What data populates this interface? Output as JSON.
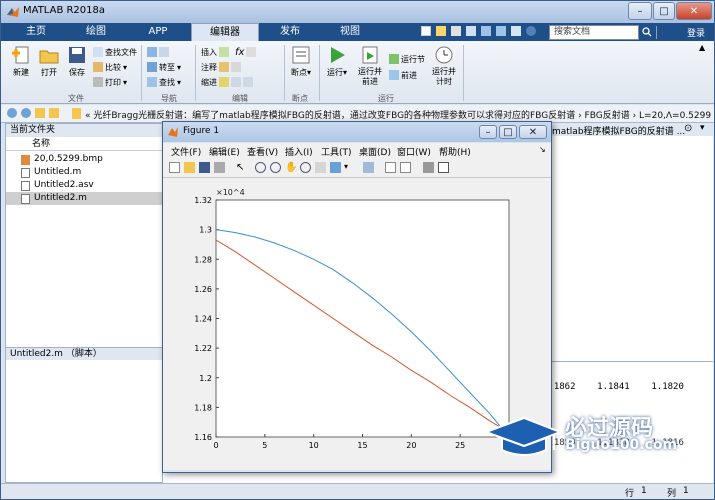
{
  "app": {
    "title": "MATLAB R2018a"
  },
  "ribbon_tabs": [
    "主页",
    "绘图",
    "APP",
    "编辑器",
    "发布",
    "视图"
  ],
  "search": {
    "placeholder": "搜索文档",
    "login": "登录"
  },
  "ribbon": {
    "file_group": {
      "label": "文件",
      "new": "新建",
      "open": "打开",
      "save": "保存",
      "find_files": "查找文件",
      "compare": "比较",
      "print": "打印"
    },
    "nav_group": {
      "label": "导航",
      "goto": "转至",
      "find": "查找"
    },
    "edit_group": {
      "label": "编辑",
      "insert": "插入",
      "comment": "注释",
      "indent": "缩进",
      "fx": "fx"
    },
    "bp_group": {
      "label": "断点",
      "breakpoint": "断点"
    },
    "run_group": {
      "label": "运行",
      "run": "运行",
      "run_advance": "运行并前进",
      "run_section": "运行节",
      "advance": "前进",
      "run_time": "运行并计时"
    }
  },
  "address": {
    "path": "« 光纤Bragg光栅反射谱：编写了matlab程序模拟FBG的反射谱，通过改变FBG的各种物理参数可以求得对应的FBG反射谱 › FBG反射谱 › L=20,Λ=0.5299"
  },
  "left_panel": {
    "header": "当前文件夹",
    "column": "名称",
    "files": [
      "20,0.5299.bmp",
      "Untitled.m",
      "Untitled2.asv",
      "Untitled2.m"
    ],
    "selected_index": 3,
    "detail_header": "Untitled2.m （脚本）"
  },
  "editor": {
    "tab_partial": "matlab程序模拟FBG的反射谱 ..."
  },
  "command": {
    "row1": "1.1862    1.1841    1.1820",
    "row2": "1.1859    1.1838    1.1816"
  },
  "status": {
    "row_label": "行",
    "row": "1",
    "col_label": "列",
    "col": "1"
  },
  "figure": {
    "title": "Figure 1",
    "menu": [
      "文件(F)",
      "编辑(E)",
      "查看(V)",
      "插入(I)",
      "工具(T)",
      "桌面(D)",
      "窗口(W)",
      "帮助(H)"
    ]
  },
  "watermark": {
    "text": "必过源码",
    "url": "Biguo100.com"
  },
  "chart_data": {
    "type": "line",
    "multiplier": "×10^4",
    "xlim": [
      0,
      30
    ],
    "ylim": [
      1.16,
      1.32
    ],
    "xticks": [
      0,
      5,
      10,
      15,
      20,
      25
    ],
    "yticks": [
      1.16,
      1.18,
      1.2,
      1.22,
      1.24,
      1.26,
      1.28,
      1.3,
      1.32
    ],
    "series": [
      {
        "color": "#3a8fd0",
        "x": [
          0,
          2,
          4,
          6,
          8,
          10,
          12,
          14,
          16,
          18,
          20,
          22,
          24,
          26,
          28,
          30
        ],
        "y": [
          1.3,
          1.298,
          1.295,
          1.291,
          1.286,
          1.28,
          1.273,
          1.264,
          1.254,
          1.243,
          1.231,
          1.218,
          1.204,
          1.19,
          1.176,
          1.16
        ]
      },
      {
        "color": "#d9552b",
        "x": [
          0,
          2,
          4,
          6,
          8,
          10,
          12,
          14,
          16,
          18,
          20,
          22,
          24,
          26,
          28,
          30
        ],
        "y": [
          1.293,
          1.285,
          1.276,
          1.267,
          1.258,
          1.249,
          1.24,
          1.231,
          1.222,
          1.214,
          1.205,
          1.197,
          1.188,
          1.18,
          1.171,
          1.163
        ]
      }
    ],
    "grid": false
  }
}
